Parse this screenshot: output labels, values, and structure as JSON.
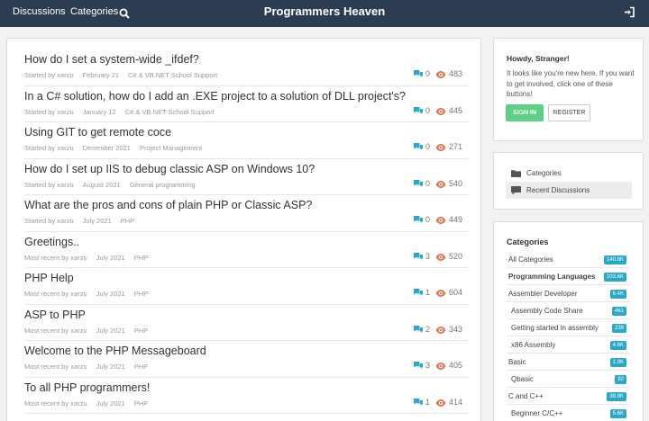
{
  "topbar": {
    "nav_discussions": "Discussions",
    "nav_categories": "Categories",
    "site_title": "Programmers Heaven",
    "search_icon": "search-icon",
    "signin_icon": "sign-in-icon"
  },
  "threads": [
    {
      "title": "How do I set a system-wide _ifdef?",
      "meta": [
        "Started by xarzu",
        "February 21",
        "C# & VB.NET School Support"
      ],
      "comments": "0",
      "views": "483"
    },
    {
      "title": "In a C# solution, how do I add an .EXE project to a solution of DLL project's?",
      "meta": [
        "Started by xarzu",
        "January 12",
        "C# & VB.NET School Support"
      ],
      "comments": "0",
      "views": "445"
    },
    {
      "title": "Using GIT to get remote coce",
      "meta": [
        "Started by xarzu",
        "December 2021",
        "Project Management"
      ],
      "comments": "0",
      "views": "271"
    },
    {
      "title": "How do I set up IIS to debug classic ASP on Windows 10?",
      "meta": [
        "Started by xarzu",
        "August 2021",
        "General programming"
      ],
      "comments": "0",
      "views": "540"
    },
    {
      "title": "What are the pros and cons of plain PHP or Classic ASP?",
      "meta": [
        "Started by xarzu",
        "July 2021",
        "PHP"
      ],
      "comments": "0",
      "views": "449"
    },
    {
      "title": "Greetings..",
      "meta": [
        "Most recent by xarzu",
        "July 2021",
        "PHP"
      ],
      "comments": "3",
      "views": "520"
    },
    {
      "title": "PHP Help",
      "meta": [
        "Most recent by xarzu",
        "July 2021",
        "PHP"
      ],
      "comments": "1",
      "views": "604"
    },
    {
      "title": "ASP to PHP",
      "meta": [
        "Most recent by xarzu",
        "July 2021",
        "PHP"
      ],
      "comments": "2",
      "views": "343"
    },
    {
      "title": "Welcome to the PHP Messageboard",
      "meta": [
        "Most recent by xarzu",
        "July 2021",
        "PHP"
      ],
      "comments": "3",
      "views": "405"
    },
    {
      "title": "To all PHP programmers!",
      "meta": [
        "Most recent by xarzu",
        "July 2021",
        "PHP"
      ],
      "comments": "1",
      "views": "414"
    }
  ],
  "howdy": {
    "heading": "Howdy, Stranger!",
    "text": "It looks like you're new here. If you want to get involved, click one of these buttons!",
    "signin_label": "SIGN IN",
    "register_label": "REGISTER"
  },
  "quicklinks": [
    {
      "label": "Categories",
      "icon": "folder-icon"
    },
    {
      "label": "Recent Discussions",
      "icon": "comment-icon"
    }
  ],
  "categories": {
    "heading": "Categories",
    "items": [
      {
        "label": "All Categories",
        "count": "140.8K",
        "bold": false,
        "indent": false
      },
      {
        "label": "Programming Languages",
        "count": "103.6K",
        "bold": true,
        "indent": false
      },
      {
        "label": "Assembler Developer",
        "count": "6.4K",
        "bold": false,
        "indent": false
      },
      {
        "label": "Assembly Code Share",
        "count": "461",
        "bold": false,
        "indent": true
      },
      {
        "label": "Getting started in assembly",
        "count": "239",
        "bold": false,
        "indent": true
      },
      {
        "label": "x86 Assembly",
        "count": "4.6K",
        "bold": false,
        "indent": true
      },
      {
        "label": "Basic",
        "count": "1.9K",
        "bold": false,
        "indent": false
      },
      {
        "label": "Qbasic",
        "count": "92",
        "bold": false,
        "indent": true
      },
      {
        "label": "C and C++",
        "count": "39.9K",
        "bold": false,
        "indent": false
      },
      {
        "label": "Beginner C/C++",
        "count": "5.6K",
        "bold": false,
        "indent": true
      }
    ]
  },
  "colors": {
    "topbar": "#2c3c51",
    "comment_icon": "#2aa8c9",
    "views_icon": "#e07b5a",
    "signin_button": "#5ecf85",
    "badge": "#2aa8c9"
  }
}
